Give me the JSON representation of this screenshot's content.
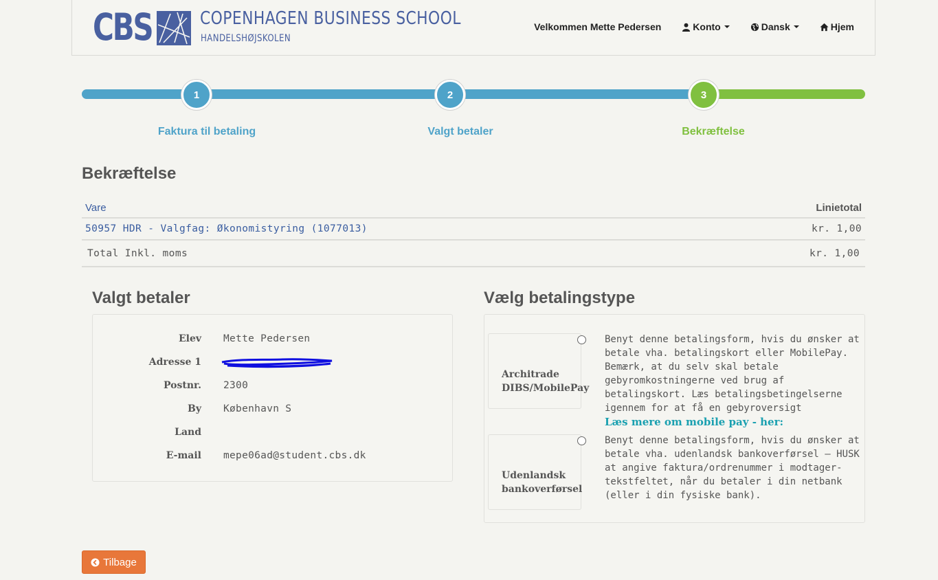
{
  "header": {
    "logo_short": "CBS",
    "logo_line1": "COPENHAGEN BUSINESS SCHOOL",
    "logo_line2": "HANDELSHØJSKOLEN",
    "welcome": "Velkommen Mette Pedersen",
    "account_label": "Konto",
    "language_label": "Dansk",
    "home_label": "Hjem"
  },
  "steps": [
    {
      "number": "1",
      "label": "Faktura til betaling",
      "color": "#4fa3c9"
    },
    {
      "number": "2",
      "label": "Valgt betaler",
      "color": "#4fa3c9"
    },
    {
      "number": "3",
      "label": "Bekræftelse",
      "color": "#80c040"
    }
  ],
  "page_title": "Bekræftelse",
  "table": {
    "col_item": "Vare",
    "col_total": "Linietotal",
    "rows": [
      {
        "item": "50957 HDR - Valgfag: Økonomistyring (1077013)",
        "total": "kr. 1,00"
      }
    ],
    "total_label": "Total Inkl. moms",
    "total_value": "kr. 1,00"
  },
  "payer": {
    "title": "Valgt betaler",
    "fields": [
      {
        "label": "Elev",
        "value": "Mette Pedersen"
      },
      {
        "label": "Adresse 1",
        "value": ""
      },
      {
        "label": "Postnr.",
        "value": "2300"
      },
      {
        "label": "By",
        "value": "København S"
      },
      {
        "label": "Land",
        "value": ""
      },
      {
        "label": "E-mail",
        "value": "mepe06ad@student.cbs.dk"
      }
    ]
  },
  "payment": {
    "title": "Vælg betalingstype",
    "options": [
      {
        "name_line1": "Architrade",
        "name_line2": "DIBS/MobilePay",
        "description": "Benyt denne betalingsform, hvis du ønsker at betale vha. betalingskort eller MobilePay. Bemærk, at du selv skal betale gebyromkostningerne ved brug af betalingskort. Læs betalingsbetingelserne igennem for at få en gebyroversigt",
        "link": "Læs mere om mobile pay - her:"
      },
      {
        "name_line1": "Udenlandsk",
        "name_line2": "bankoverførsel",
        "description": "Benyt denne betalingsform, hvis du ønsker at betale vha. udenlandsk bankoverførsel – HUSK at angive faktura/ordrenummer i modtager-tekstfeltet, når du betaler i din netbank (eller i din fysiske bank)."
      }
    ]
  },
  "back_button": "Tilbage",
  "icons": {
    "account": "user-icon",
    "language": "globe-icon",
    "home": "home-icon",
    "back": "arrow-circle-left-icon"
  },
  "colors": {
    "brand": "#4960a0",
    "step_blue": "#4fa3c9",
    "step_green": "#80c040",
    "back_button": "#e8773a",
    "link_teal": "#1aa0b0"
  }
}
